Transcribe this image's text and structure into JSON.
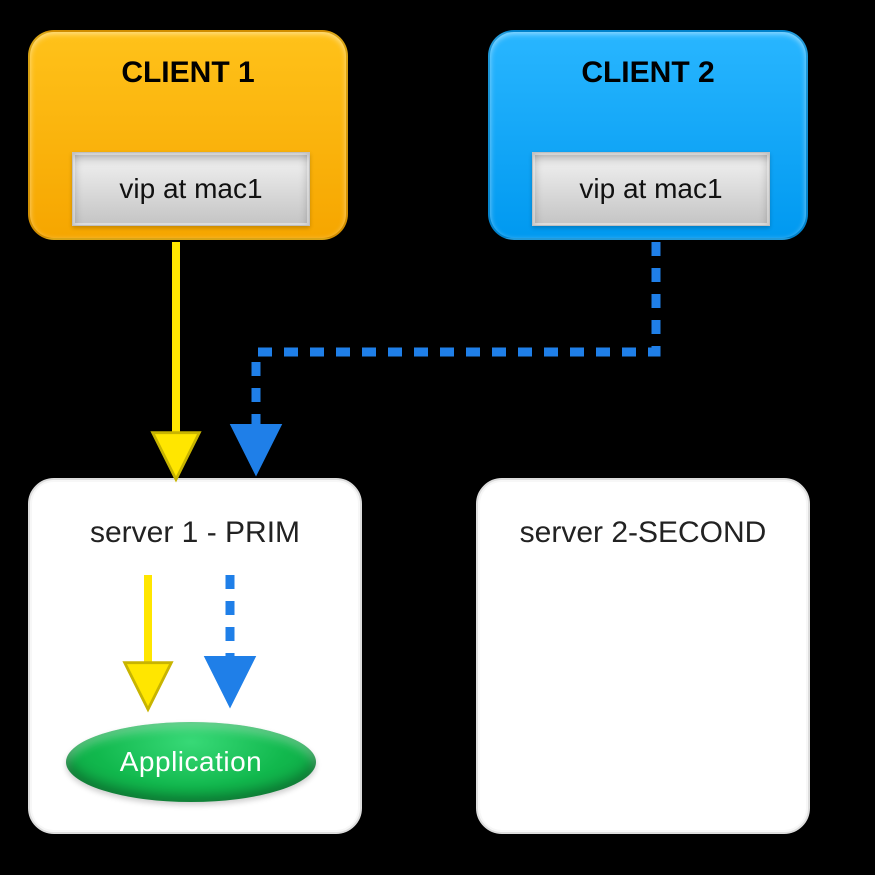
{
  "clients": {
    "c1": {
      "title": "CLIENT 1",
      "plate": "vip at mac1"
    },
    "c2": {
      "title": "CLIENT 2",
      "plate": "vip at mac1"
    }
  },
  "servers": {
    "s1": {
      "title": "server 1 - PRIM",
      "app_label": "Application"
    },
    "s2": {
      "title": "server 2-SECOND"
    }
  },
  "arrows": {
    "client1_to_server1": {
      "style": "solid",
      "color": "#ffe600"
    },
    "client2_to_server1": {
      "style": "dashed",
      "color": "#1f7fe8"
    },
    "inside_server1_yellow": {
      "style": "solid",
      "color": "#ffe600"
    },
    "inside_server1_blue": {
      "style": "dashed",
      "color": "#1f7fe8"
    }
  },
  "colors": {
    "client1_bg": "#f7aa00",
    "client2_bg": "#08a3ff",
    "server_bg": "#ffffff",
    "app_bg": "#12b74e",
    "page_bg": "#000000"
  }
}
